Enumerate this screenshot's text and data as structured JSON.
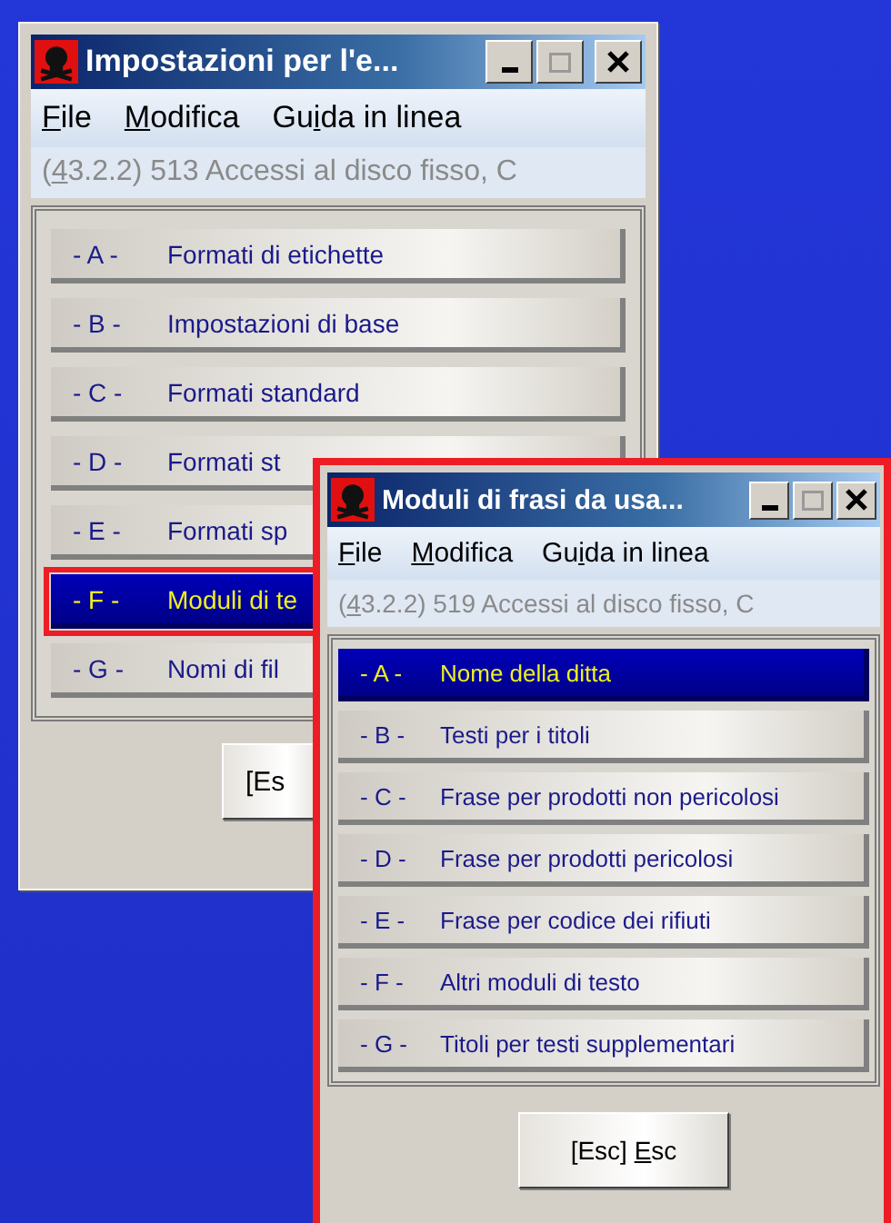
{
  "windows": [
    {
      "title": "Impostazioni per l'e...",
      "framed": false,
      "menu": [
        {
          "key": "F",
          "post": "ile"
        },
        {
          "key": "M",
          "post": "odifica"
        },
        {
          "pre": "Gu",
          "key": "i",
          "post": "da in linea"
        }
      ],
      "status": {
        "pre": "(",
        "key": "4",
        "post": "3.2.2) 513 Accessi al disco fisso, C"
      },
      "items": [
        {
          "code": "- A -",
          "label": "Formati di etichette",
          "selected": false,
          "highlighted": false
        },
        {
          "code": "- B -",
          "label": "Impostazioni di base",
          "selected": false,
          "highlighted": false
        },
        {
          "code": "- C -",
          "label": "Formati standard",
          "selected": false,
          "highlighted": false
        },
        {
          "code": "- D -",
          "label": "Formati st",
          "selected": false,
          "highlighted": false
        },
        {
          "code": "- E -",
          "label": "Formati sp",
          "selected": false,
          "highlighted": false
        },
        {
          "code": "- F -",
          "label": "Moduli di te",
          "selected": true,
          "highlighted": true
        },
        {
          "code": "- G -",
          "label": "Nomi di fil",
          "selected": false,
          "highlighted": false
        }
      ],
      "button": {
        "pre": "[Es"
      }
    },
    {
      "title": "Moduli di frasi da usa...",
      "framed": true,
      "menu": [
        {
          "key": "F",
          "post": "ile"
        },
        {
          "key": "M",
          "post": "odifica"
        },
        {
          "pre": "Gu",
          "key": "i",
          "post": "da in linea"
        }
      ],
      "status": {
        "pre": "(",
        "key": "4",
        "post": "3.2.2) 519 Accessi al disco fisso, C"
      },
      "items": [
        {
          "code": "- A -",
          "label": "Nome della ditta",
          "selected": true,
          "highlighted": false
        },
        {
          "code": "- B -",
          "label": "Testi per i titoli",
          "selected": false,
          "highlighted": false
        },
        {
          "code": "- C -",
          "label": "Frase per prodotti non pericolosi",
          "selected": false,
          "highlighted": false
        },
        {
          "code": "- D -",
          "label": "Frase per prodotti pericolosi",
          "selected": false,
          "highlighted": false
        },
        {
          "code": "- E -",
          "label": "Frase per codice dei rifiuti",
          "selected": false,
          "highlighted": false
        },
        {
          "code": "- F -",
          "label": "Altri moduli di testo",
          "selected": false,
          "highlighted": false
        },
        {
          "code": "- G -",
          "label": "Titoli per testi supplementari",
          "selected": false,
          "highlighted": false
        }
      ],
      "button": {
        "pre": "[Esc] ",
        "key": "E",
        "post": "sc"
      }
    }
  ]
}
